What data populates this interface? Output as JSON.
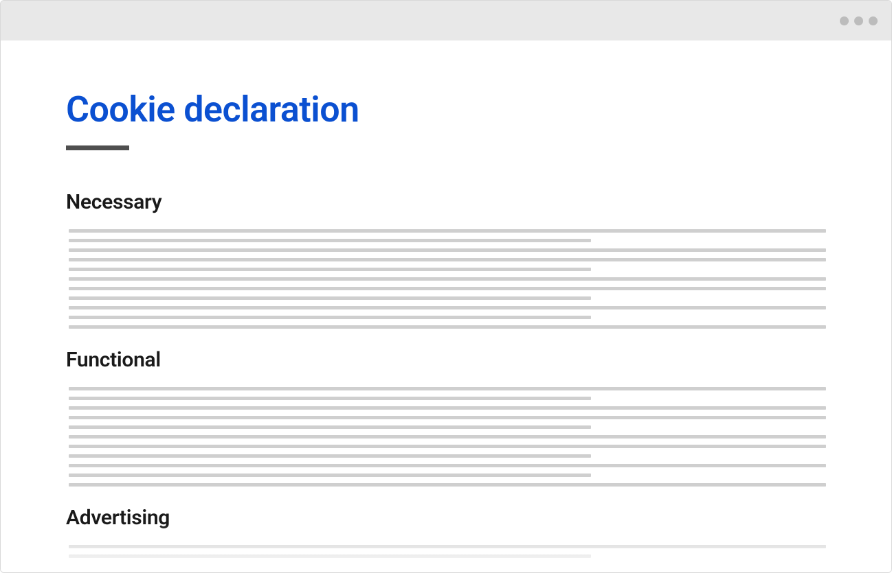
{
  "page": {
    "title": "Cookie declaration"
  },
  "sections": [
    {
      "heading": "Necessary"
    },
    {
      "heading": "Functional"
    },
    {
      "heading": "Advertising"
    }
  ]
}
